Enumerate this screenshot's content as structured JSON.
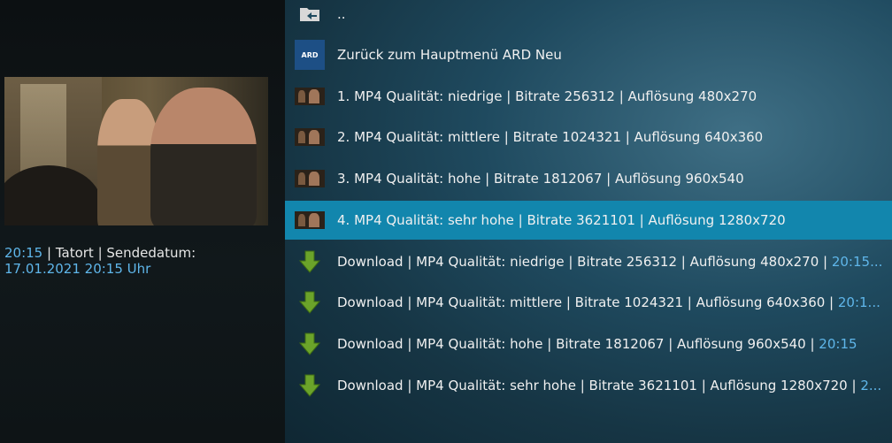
{
  "sidebar": {
    "info_time": "20:15",
    "info_sep": " | Tatort | Sendedatum:",
    "info_date": "17.01.2021 20:15 Uhr"
  },
  "list": {
    "items": [
      {
        "label": "..",
        "icon": "folder-back-icon"
      },
      {
        "label": "Zurück zum Hauptmenü ARD Neu",
        "icon": "ard-logo-icon",
        "logo_text": "ARD"
      },
      {
        "label": "1. MP4 Qualität: niedrige  |  Bitrate 256312 |  Auflösung 480x270",
        "icon": "video-thumbnail-icon"
      },
      {
        "label": "2. MP4 Qualität: mittlere  |  Bitrate 1024321  |  Auflösung 640x360",
        "icon": "video-thumbnail-icon"
      },
      {
        "label": "3. MP4 Qualität: hohe  |  Bitrate 1812067 |  Auflösung 960x540",
        "icon": "video-thumbnail-icon"
      },
      {
        "label": "4. MP4 Qualität: sehr hohe  |  Bitrate 3621101 |  Auflösung 1280x720",
        "icon": "video-thumbnail-icon",
        "selected": true
      },
      {
        "label": "Download | MP4 Qualität: niedrige | Bitrate 256312 | Auflösung 480x270 | ",
        "suffix": "20:15...",
        "icon": "download-arrow-icon"
      },
      {
        "label": "Download | MP4 Qualität: mittlere | Bitrate 1024321 | Auflösung 640x360 | ",
        "suffix": "20:1...",
        "icon": "download-arrow-icon"
      },
      {
        "label": "Download | MP4 Qualität: hohe | Bitrate 1812067 | Auflösung 960x540 | ",
        "suffix": "20:15",
        "icon": "download-arrow-icon"
      },
      {
        "label": "Download | MP4 Qualität: sehr hohe | Bitrate 3621101 | Auflösung 1280x720 | ",
        "suffix": "2...",
        "icon": "download-arrow-icon"
      }
    ]
  },
  "colors": {
    "selected_row": "#1286ad",
    "accent_blue": "#5fb6ea",
    "download_green": "#6ba32a"
  }
}
